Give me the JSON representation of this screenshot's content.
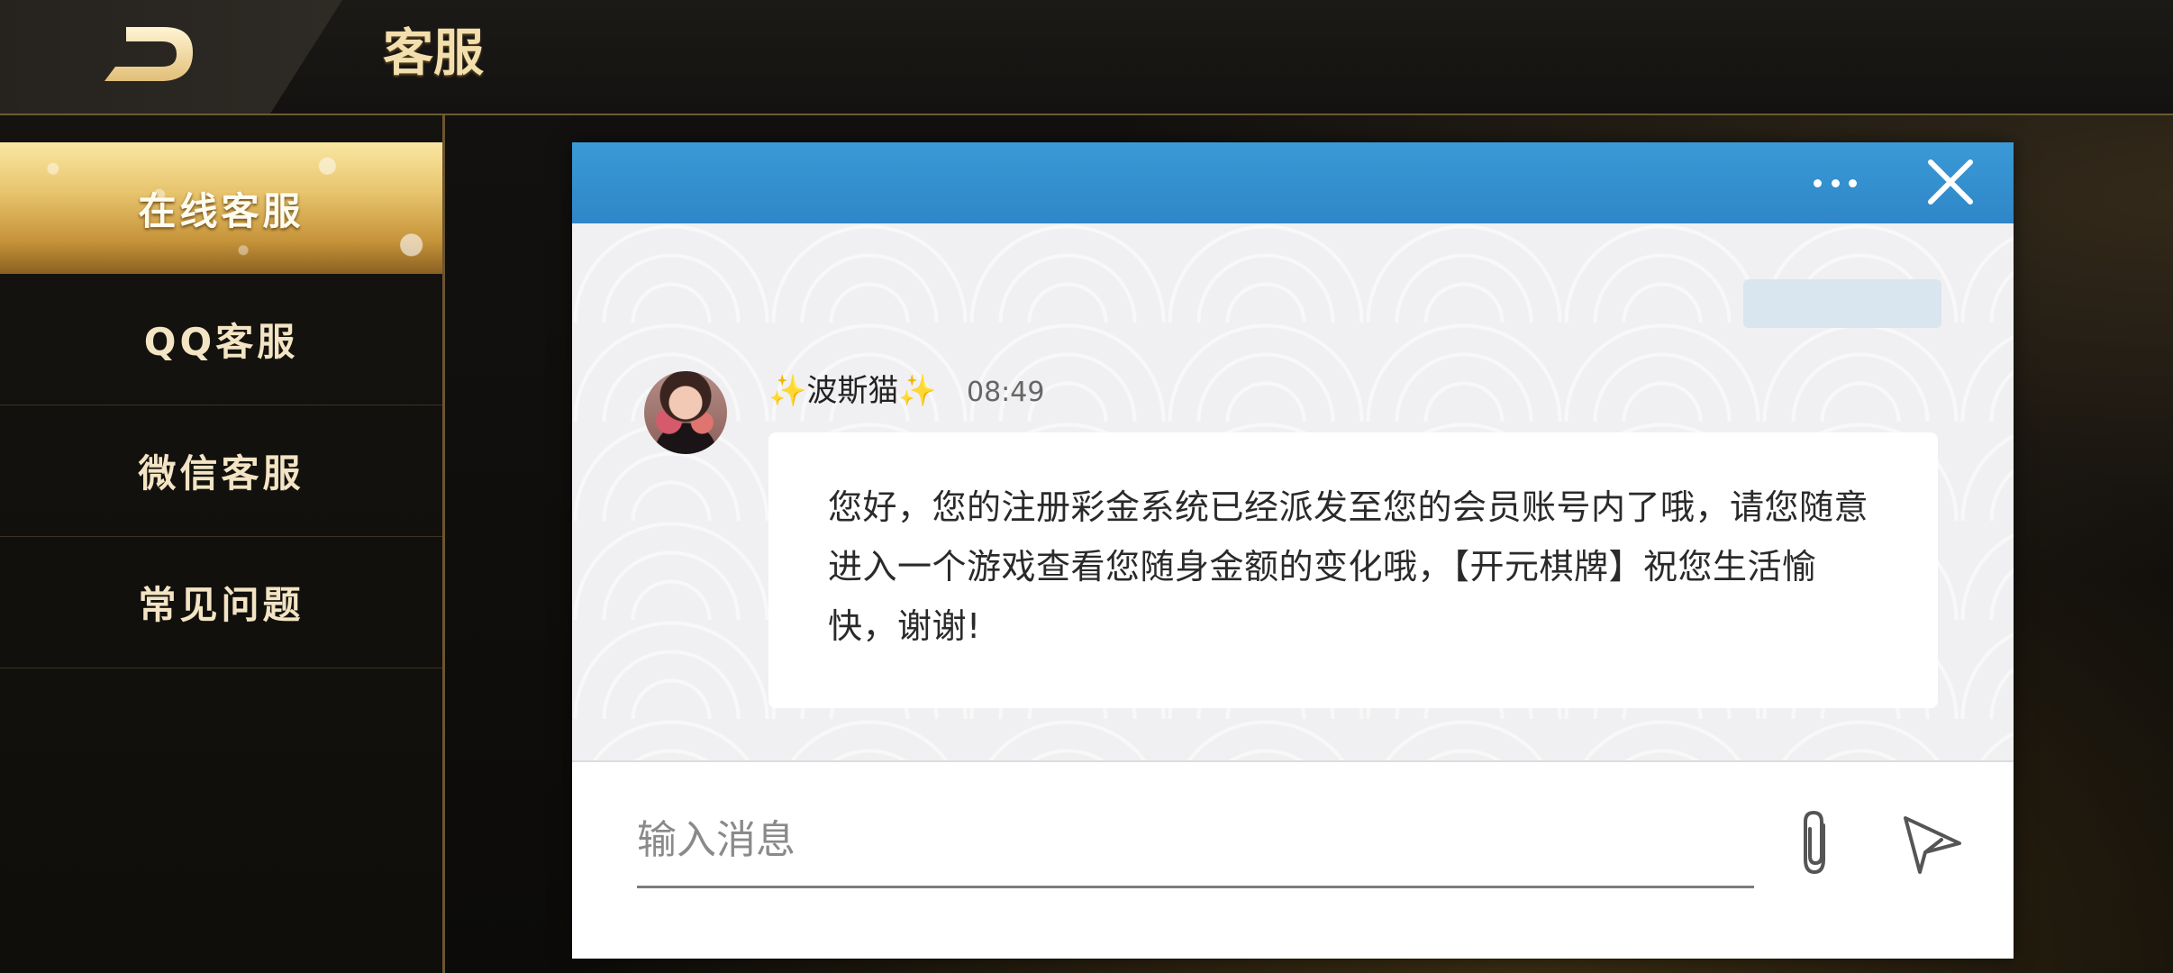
{
  "header": {
    "title": "客服",
    "back_icon": "back-arrow-icon"
  },
  "sidebar": {
    "items": [
      {
        "label": "在线客服",
        "active": true
      },
      {
        "label": "QQ客服",
        "active": false
      },
      {
        "label": "微信客服",
        "active": false
      },
      {
        "label": "常见问题",
        "active": false
      }
    ]
  },
  "chat": {
    "header": {
      "more_icon": "more-dots-icon",
      "close_icon": "close-icon",
      "color": "#3a9ad6"
    },
    "messages": [
      {
        "sender": "✨波斯猫✨",
        "time": "08:49",
        "text": "您好，您的注册彩金系统已经派发至您的会员账号内了哦，请您随意进入一个游戏查看您随身金额的变化哦，【开元棋牌】祝您生活愉快，谢谢!"
      }
    ],
    "input": {
      "placeholder": "输入消息",
      "value": ""
    },
    "attach_icon": "paperclip-icon",
    "send_icon": "send-icon"
  },
  "colors": {
    "gold": "#f3dfae",
    "blue": "#2f86c8",
    "dark": "#131210"
  }
}
